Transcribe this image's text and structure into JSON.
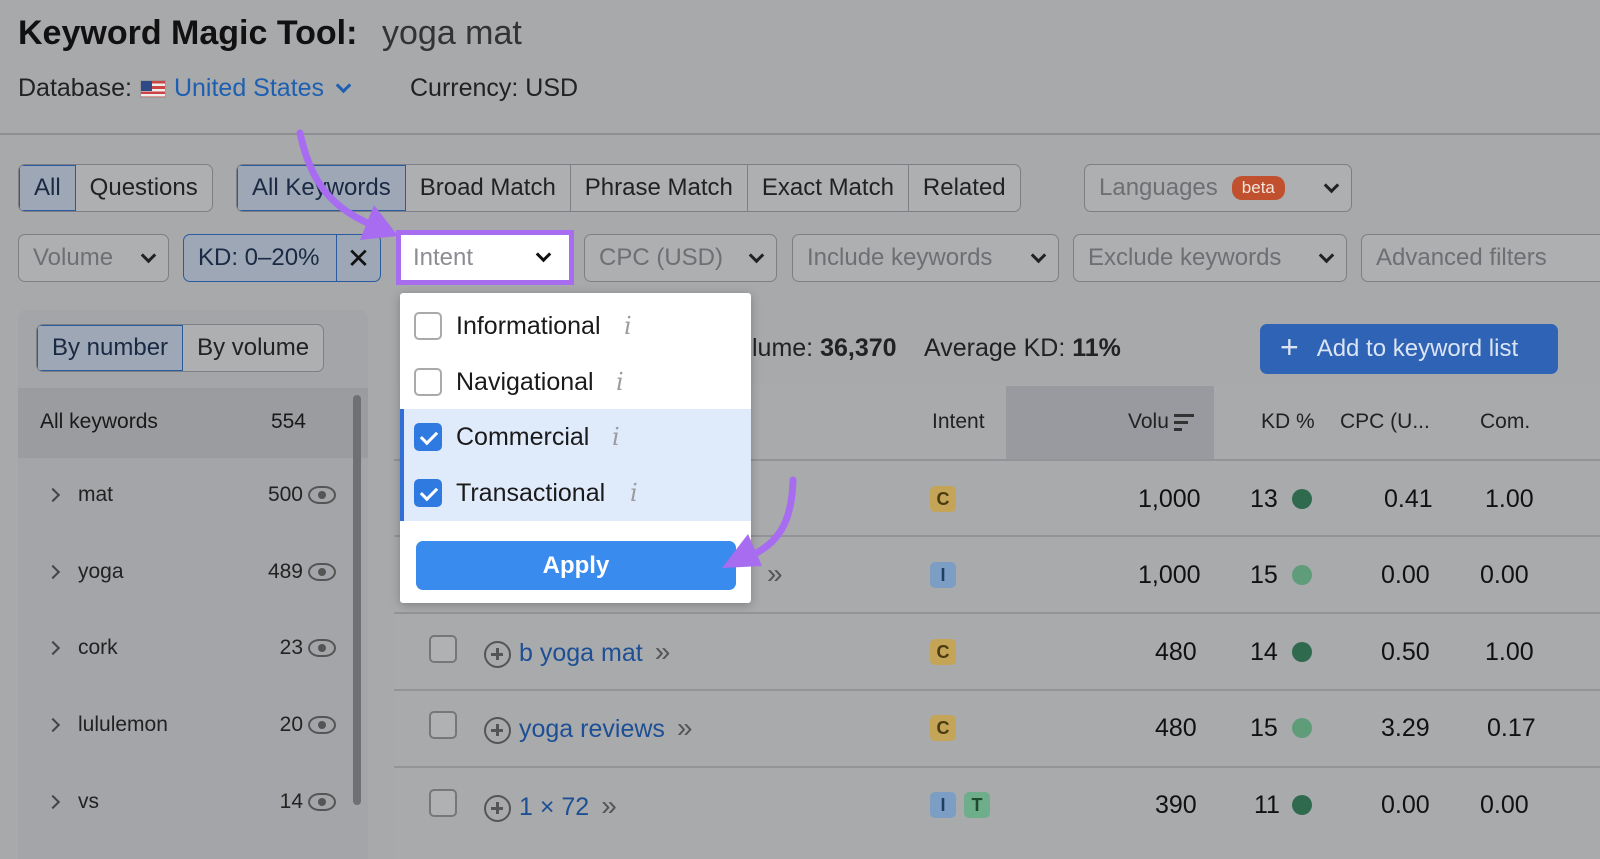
{
  "header": {
    "title": "Keyword Magic Tool:",
    "query": "yoga mat",
    "database_label": "Database:",
    "database_value": "United States",
    "currency": "Currency: USD"
  },
  "match_tabs": {
    "group1": [
      "All",
      "Questions"
    ],
    "group2": [
      "All Keywords",
      "Broad Match",
      "Phrase Match",
      "Exact Match",
      "Related"
    ],
    "languages": "Languages",
    "beta": "beta"
  },
  "filters": {
    "volume": "Volume",
    "kd": "KD: 0–20%",
    "intent": "Intent",
    "cpc": "CPC (USD)",
    "include": "Include keywords",
    "exclude": "Exclude keywords",
    "advanced": "Advanced filters"
  },
  "intent_dropdown": {
    "options": [
      {
        "label": "Informational",
        "checked": false
      },
      {
        "label": "Navigational",
        "checked": false
      },
      {
        "label": "Commercial",
        "checked": true
      },
      {
        "label": "Transactional",
        "checked": true
      }
    ],
    "info_glyph": "i",
    "apply": "Apply"
  },
  "sidebar": {
    "toggle": [
      "By number",
      "By volume"
    ],
    "all_label": "All keywords",
    "all_count": "554",
    "groups": [
      {
        "label": "mat",
        "count": "500"
      },
      {
        "label": "yoga",
        "count": "489"
      },
      {
        "label": "cork",
        "count": "23"
      },
      {
        "label": "lululemon",
        "count": "20"
      },
      {
        "label": "vs",
        "count": "14"
      }
    ]
  },
  "stats": {
    "volume_label": "lume:",
    "volume_value": "36,370",
    "kd_label": "Average KD:",
    "kd_value": "11%"
  },
  "add_button": "Add to keyword list",
  "table": {
    "headers": [
      "Intent",
      "Volu",
      "KD %",
      "CPC (U...",
      "Com."
    ],
    "rows": [
      {
        "keyword": "",
        "intent": [
          "C"
        ],
        "volume": "1,000",
        "kd": "13",
        "kd_level": "dark",
        "cpc": "0.41",
        "com": "1.00"
      },
      {
        "keyword": "",
        "intent": [
          "I"
        ],
        "volume": "1,000",
        "kd": "15",
        "kd_level": "light",
        "cpc": "0.00",
        "com": "0.00"
      },
      {
        "keyword": "b yoga mat",
        "intent": [
          "C"
        ],
        "volume": "480",
        "kd": "14",
        "kd_level": "dark",
        "cpc": "0.50",
        "com": "1.00"
      },
      {
        "keyword": "yoga reviews",
        "intent": [
          "C"
        ],
        "volume": "480",
        "kd": "15",
        "kd_level": "light",
        "cpc": "3.29",
        "com": "0.17"
      },
      {
        "keyword": "1 × 72",
        "intent": [
          "I",
          "T"
        ],
        "volume": "390",
        "kd": "11",
        "kd_level": "dark",
        "cpc": "0.00",
        "com": "0.00"
      }
    ]
  },
  "colors": {
    "highlight_arrow": "#a86cf0",
    "accent_blue": "#3a8bee"
  }
}
